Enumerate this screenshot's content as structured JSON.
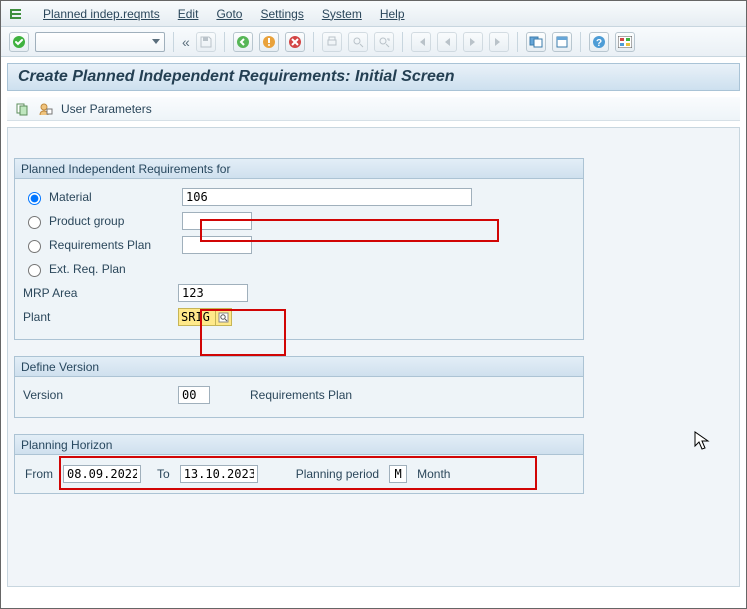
{
  "menu": {
    "items": [
      "Planned indep.reqmts",
      "Edit",
      "Goto",
      "Settings",
      "System",
      "Help"
    ]
  },
  "toolbar": {
    "back_chevrons": "«"
  },
  "title": "Create Planned Independent Requirements: Initial Screen",
  "app_toolbar": {
    "user_params": "User Parameters"
  },
  "group1": {
    "header": "Planned Independent Requirements for",
    "options": {
      "material": "Material",
      "product_group": "Product group",
      "requirements_plan": "Requirements Plan",
      "ext_req_plan": "Ext. Req. Plan"
    },
    "material_value": "106",
    "mrp_area_label": "MRP Area",
    "mrp_area_value": "123",
    "plant_label": "Plant",
    "plant_value": "SRIG"
  },
  "group2": {
    "header": "Define Version",
    "version_label": "Version",
    "version_value": "00",
    "req_plan_label": "Requirements Plan"
  },
  "group3": {
    "header": "Planning Horizon",
    "from_label": "From",
    "from_value": "08.09.2022",
    "to_label": "To",
    "to_value": "13.10.2023",
    "period_label": "Planning period",
    "period_code": "M",
    "period_text": "Month"
  }
}
